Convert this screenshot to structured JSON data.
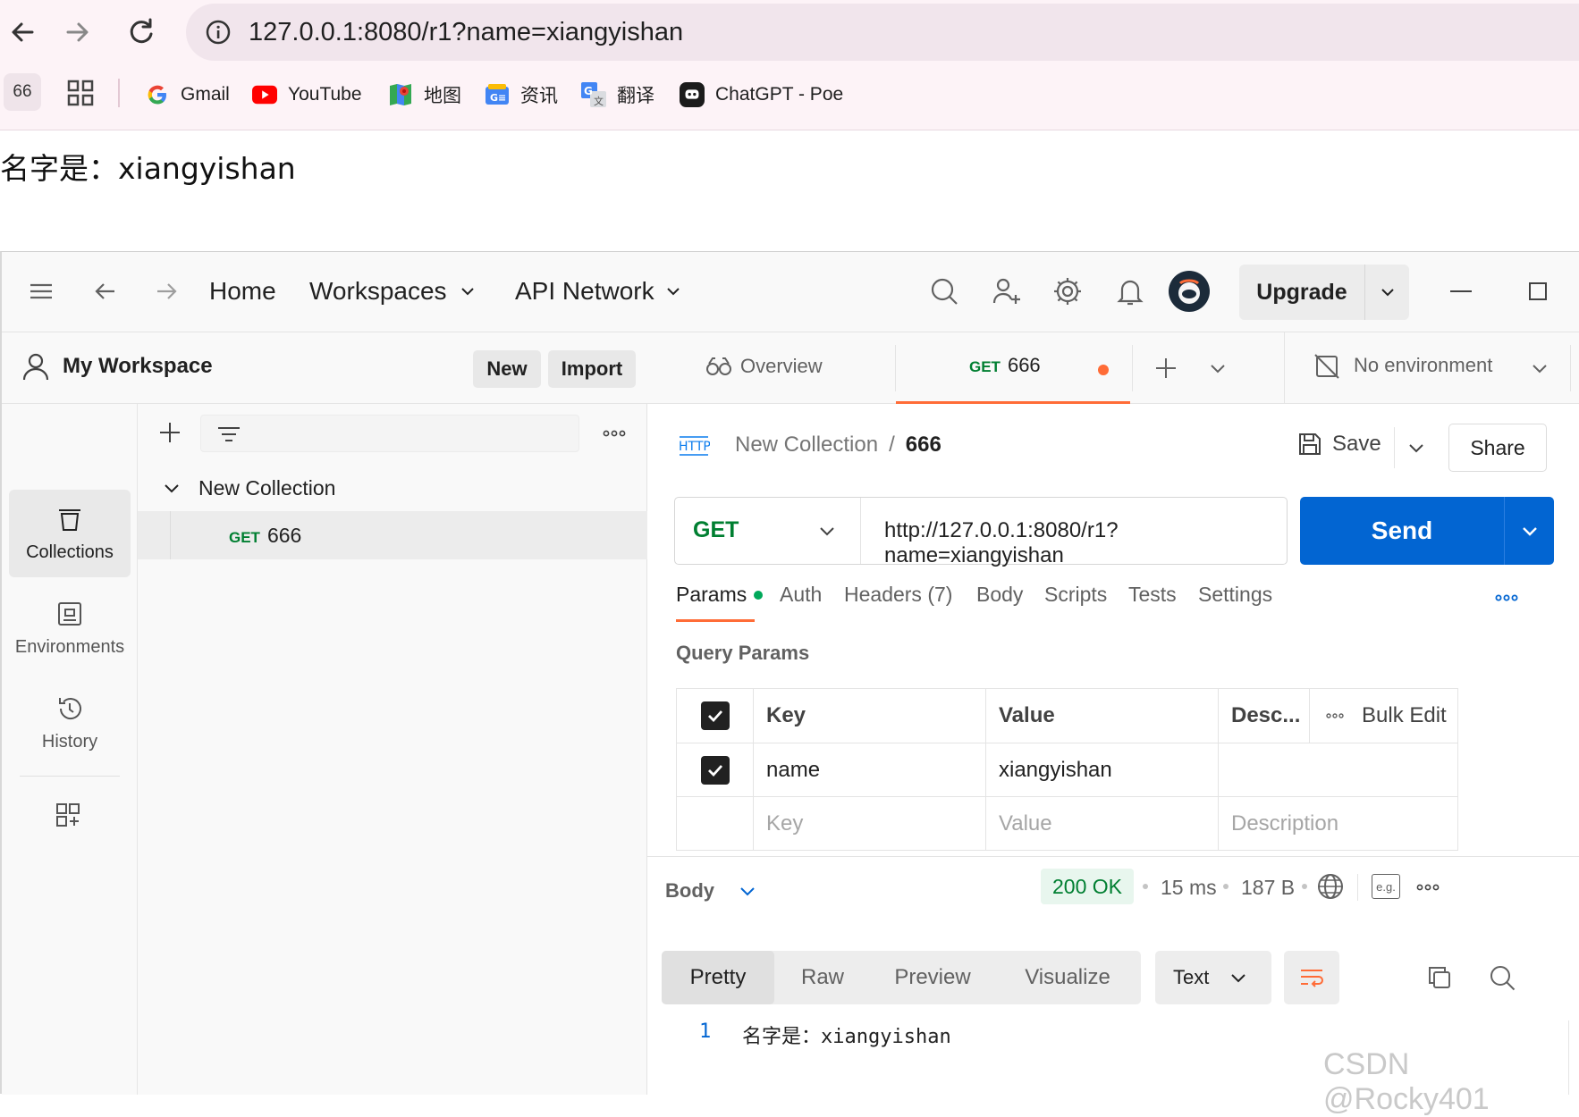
{
  "browser": {
    "url": "127.0.0.1:8080/r1?name=xiangyishan",
    "tab_count": "66",
    "bookmarks": [
      {
        "label": "Gmail",
        "icon": "gmail-icon"
      },
      {
        "label": "YouTube",
        "icon": "youtube-icon"
      },
      {
        "label": "地图",
        "icon": "maps-icon"
      },
      {
        "label": "资讯",
        "icon": "news-icon"
      },
      {
        "label": "翻译",
        "icon": "translate-icon"
      },
      {
        "label": "ChatGPT - Poe",
        "icon": "poe-icon"
      }
    ],
    "page_text": "名字是：xiangyishan"
  },
  "postman": {
    "topnav": {
      "home": "Home",
      "workspaces": "Workspaces",
      "api_network": "API Network",
      "upgrade": "Upgrade"
    },
    "workspace": {
      "title": "My Workspace",
      "new_label": "New",
      "import_label": "Import"
    },
    "sidebar": {
      "items": [
        {
          "label": "Collections",
          "icon": "collections-icon"
        },
        {
          "label": "Environments",
          "icon": "environments-icon"
        },
        {
          "label": "History",
          "icon": "history-icon"
        }
      ]
    },
    "collection": {
      "name": "New Collection",
      "request_method": "GET",
      "request_name": "666"
    },
    "tabs": {
      "overview": "Overview",
      "active_method": "GET",
      "active_name": "666",
      "environment": "No environment"
    },
    "request": {
      "breadcrumb_collection": "New Collection",
      "breadcrumb_sep": "/",
      "breadcrumb_name": "666",
      "save_label": "Save",
      "share_label": "Share",
      "method": "GET",
      "url": "http://127.0.0.1:8080/r1?name=xiangyishan",
      "send_label": "Send",
      "subtabs": [
        "Params",
        "Auth",
        "Headers (7)",
        "Body",
        "Scripts",
        "Tests",
        "Settings"
      ],
      "query_params_title": "Query Params",
      "columns": {
        "key": "Key",
        "value": "Value",
        "desc": "Desc...",
        "bulk_edit": "Bulk Edit"
      },
      "rows": [
        {
          "key": "name",
          "value": "xiangyishan"
        }
      ],
      "placeholders": {
        "key": "Key",
        "value": "Value",
        "desc": "Description"
      }
    },
    "response": {
      "body_label": "Body",
      "status": "200 OK",
      "time": "15 ms",
      "size": "187 B",
      "eg_label": "e.g.",
      "view_tabs": [
        "Pretty",
        "Raw",
        "Preview",
        "Visualize"
      ],
      "format": "Text",
      "line_number": "1",
      "line_content": "名字是：xiangyishan"
    }
  },
  "watermark": "CSDN @Rocky401",
  "colors": {
    "accent_orange": "#ff6c37",
    "send_blue": "#0265d2",
    "get_green": "#007f31",
    "status_green": "#007f31"
  }
}
